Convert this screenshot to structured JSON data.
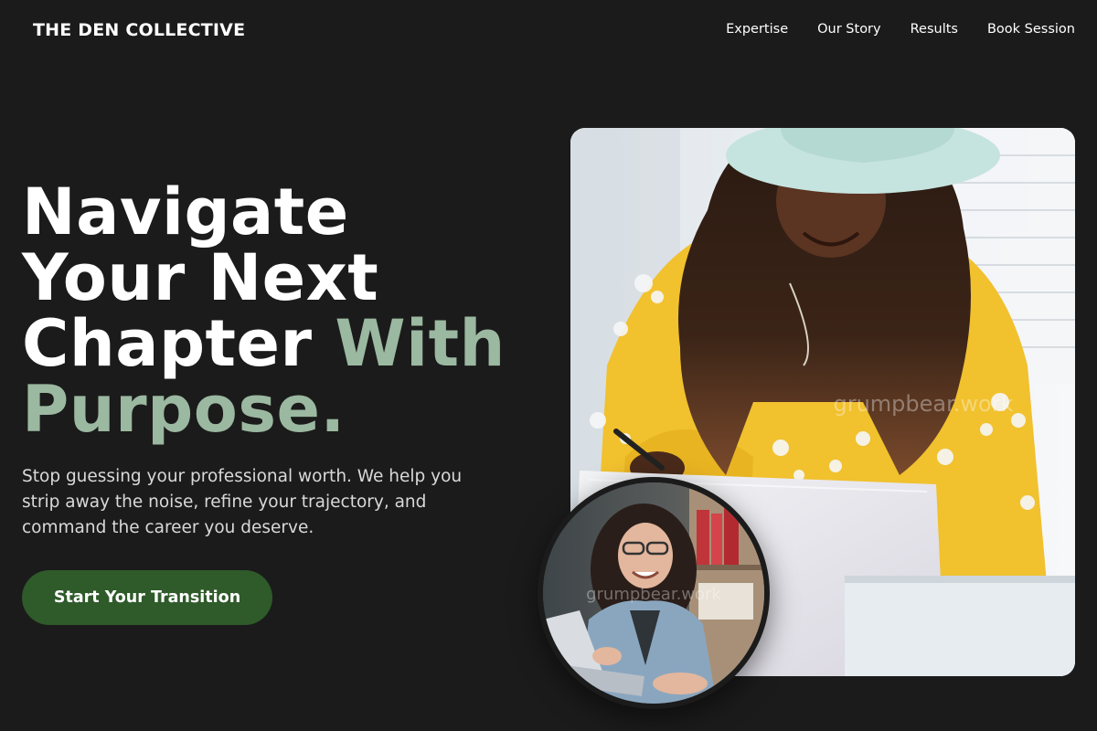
{
  "header": {
    "brand": "THE DEN COLLECTIVE",
    "nav": [
      "Expertise",
      "Our Story",
      "Results",
      "Book Session"
    ]
  },
  "hero": {
    "headline_line1": "Navigate",
    "headline_line2": "Your Next",
    "headline_line3_plain": "Chapter ",
    "headline_line3_accent": "With",
    "headline_line4_accent": "Purpose.",
    "subtext": "Stop guessing your professional worth. We help you strip away the noise, refine your trajectory, and command the career you deserve.",
    "cta_label": "Start Your Transition"
  },
  "images": {
    "main_photo_watermark": "grumpbear.work",
    "circle_photo_watermark": "grumpbear.work",
    "main_photo_icon": "woman-writing-photo",
    "circle_photo_icon": "woman-laptop-photo"
  },
  "colors": {
    "background": "#1b1b1b",
    "accent_text": "#9bb8a0",
    "cta_background": "#2f5a2a"
  }
}
